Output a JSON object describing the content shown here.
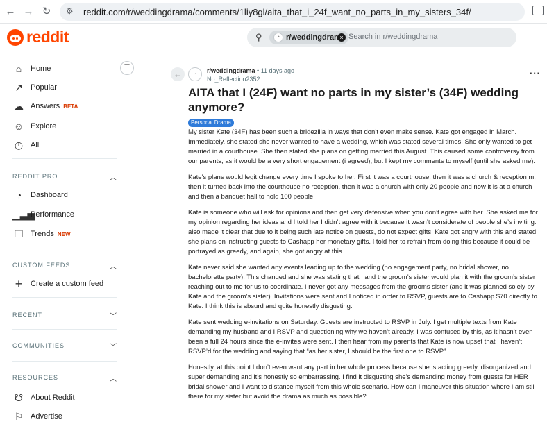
{
  "browser": {
    "url": "reddit.com/r/weddingdrama/comments/1liy8gl/aita_that_i_24f_want_no_parts_in_my_sisters_34f/"
  },
  "header": {
    "logo_text": "reddit",
    "search_chip": "r/weddingdrama",
    "search_placeholder": "Search in r/weddingdrama"
  },
  "sidebar": {
    "main": [
      {
        "label": "Home",
        "icon": "home-icon"
      },
      {
        "label": "Popular",
        "icon": "popular-icon"
      },
      {
        "label": "Answers",
        "icon": "answers-icon",
        "badge": "BETA"
      },
      {
        "label": "Explore",
        "icon": "explore-icon"
      },
      {
        "label": "All",
        "icon": "all-icon"
      }
    ],
    "reddit_pro": {
      "title": "REDDIT PRO",
      "items": [
        {
          "label": "Dashboard",
          "icon": "dashboard-icon"
        },
        {
          "label": "Performance",
          "icon": "performance-icon"
        },
        {
          "label": "Trends",
          "icon": "trends-icon",
          "badge": "NEW"
        }
      ]
    },
    "custom_feeds": {
      "title": "CUSTOM FEEDS",
      "items": [
        {
          "label": "Create a custom feed",
          "icon": "plus-icon"
        }
      ]
    },
    "recent": {
      "title": "RECENT"
    },
    "communities": {
      "title": "COMMUNITIES"
    },
    "resources": {
      "title": "RESOURCES",
      "items": [
        {
          "label": "About Reddit",
          "icon": "about-icon"
        },
        {
          "label": "Advertise",
          "icon": "advertise-icon"
        }
      ]
    }
  },
  "post": {
    "subreddit": "r/weddingdrama",
    "time": "11 days ago",
    "author": "No_Reflection2352",
    "title": "AITA that I (24F) want no parts in my sister’s (34F) wedding anymore?",
    "flair": "Personal Drama",
    "paragraphs": [
      "My sister Kate (34F) has been such a bridezilla in ways that don’t even make sense. Kate got engaged in March. Immediately, she stated she never wanted to have a wedding, which was stated several times. She only wanted to get married in a courthouse. She then stated she plans on getting married this August. This caused some controversy from our parents, as it would be a very short engagement (i agreed), but I kept my comments to myself (until she asked me).",
      "Kate’s plans would legit change every time I spoke to her. First it was a courthouse, then it was a church & reception m, then it turned back into the courthouse no reception, then it was a church with only 20 people and now it is at a church and then a banquet hall to hold 100 people.",
      "Kate is someone who will ask for opinions and then get very defensive when you don’t agree with her. She asked me for my opinion regarding her ideas and I told her I didn’t agree with it because it wasn’t considerate of people she’s inviting. I also made it clear that due to it being such late notice on guests, do not expect gifts. Kate got angry with this and stated she plans on instructing guests to Cashapp her monetary gifts. I told her to refrain from doing this because it could be portrayed as greedy, and again, she got angry at this.",
      "Kate never said she wanted any events leading up to the wedding (no engagement party, no bridal shower, no bachelorette party). This changed and she was stating that I and the groom’s sister would plan it with the groom’s sister reaching out to me for us to coordinate. I never got any messages from the grooms sister (and it was planned solely by Kate and the groom’s sister). Invitations were sent and I noticed in order to RSVP, guests are to Cashapp $70 directly to Kate. I think this is absurd and quite honestly disgusting.",
      "Kate sent wedding e-invitations on Saturday. Guests are instructed to RSVP in July. I get multiple texts from Kate demanding my husband and I RSVP and questioning why we haven’t already. I was confused by this, as it hasn’t even been a full 24 hours since the e-invites were sent. I then hear from my parents that Kate is now upset that I haven’t RSVP’d for the wedding and saying that “as her sister, I should be the first one to RSVP”.",
      "Honestly, at this point I don’t even want any part in her whole process because she is acting greedy, disorganized and super demanding and it’s honestly so embarrassing. I find it disgusting she’s demanding money from guests for HER bridal shower and I want to distance myself from this whole scenario. How can I maneuver this situation where I am still there for my sister but avoid the drama as much as possible?"
    ]
  },
  "colors": {
    "brand": "#ff4500",
    "flair": "#2f7bd9",
    "badge": "#d93900"
  }
}
